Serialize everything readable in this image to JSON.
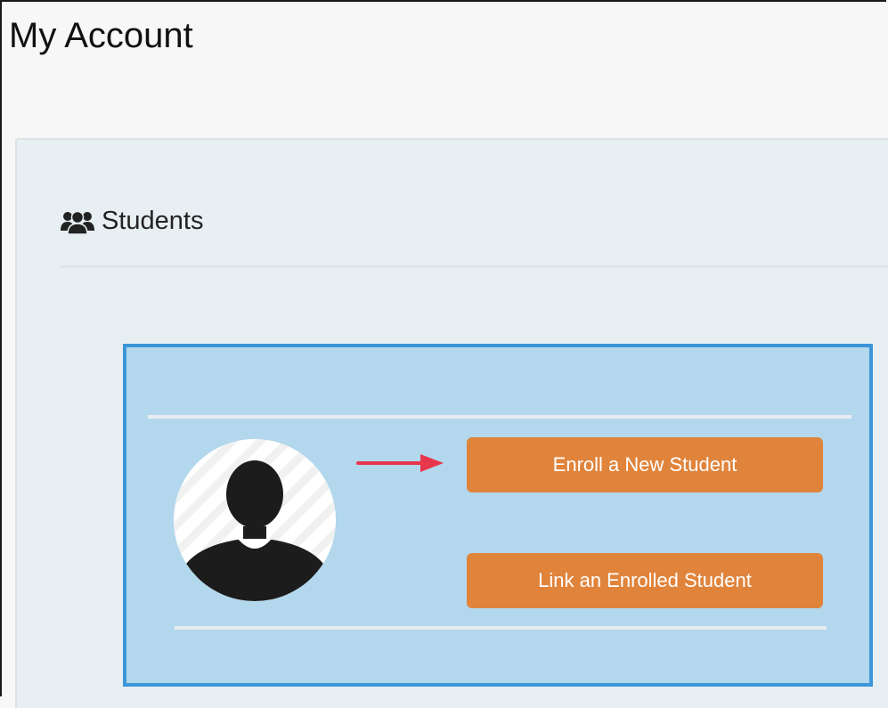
{
  "page": {
    "title": "My Account"
  },
  "students_section": {
    "title": "Students",
    "icon": "users-icon"
  },
  "student_card": {
    "avatar_icon": "user-avatar-icon",
    "pointer_icon": "arrow-right-icon",
    "enroll_button_label": "Enroll a New Student",
    "link_button_label": "Link an Enrolled Student"
  },
  "colors": {
    "button_orange": "#e0843c",
    "card_background": "#b3d7ec",
    "card_border": "#3c96d8",
    "arrow_red": "#e8364a"
  }
}
